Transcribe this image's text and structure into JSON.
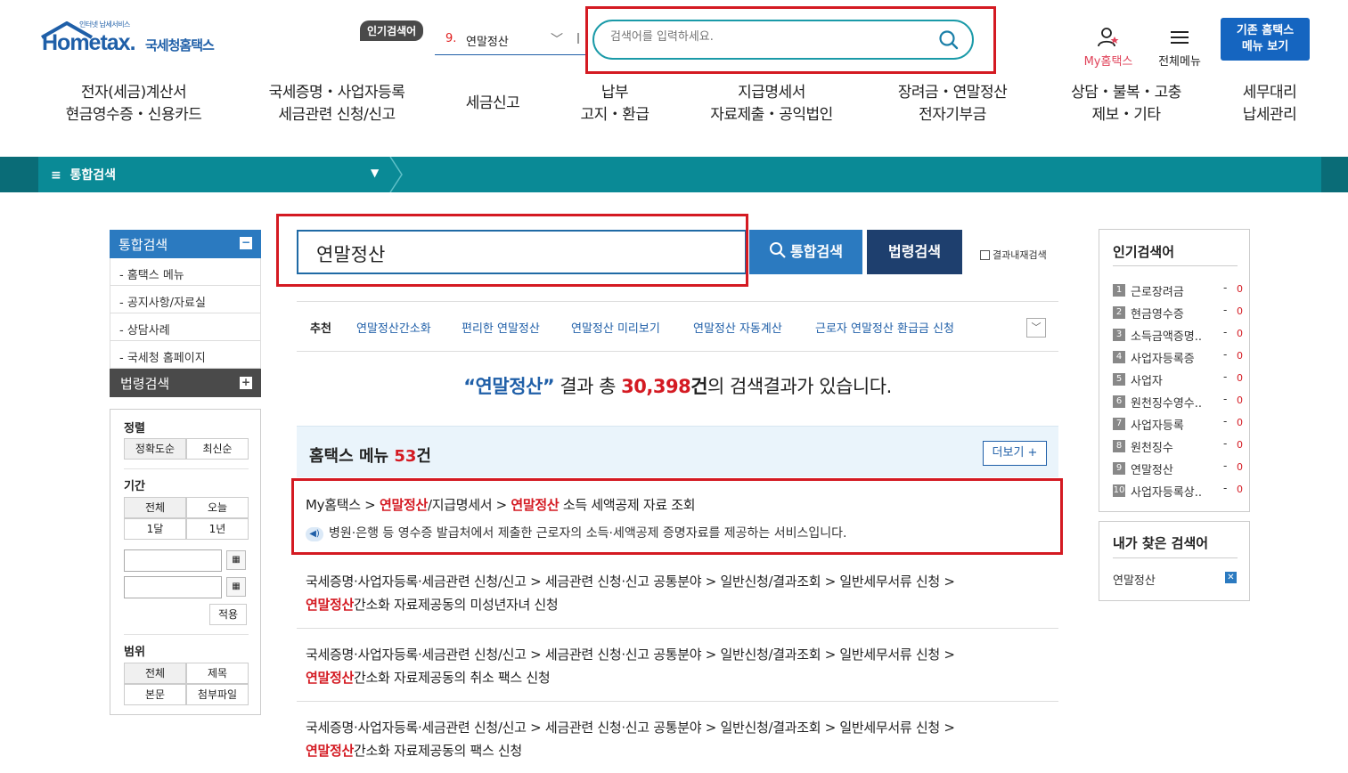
{
  "header": {
    "logo_small": "인터넷 납세서비스",
    "logo_main": "Hometax.",
    "logo_kr": "국세청홈택스",
    "popular_badge": "인기검색어",
    "popular_rank_num": "9.",
    "popular_rank_kw": "연말정산",
    "search_placeholder": "검색어를 입력하세요.",
    "myhometax": "My홈택스",
    "allmenu": "전체메뉴",
    "old_menu_line1": "기존 홈택스",
    "old_menu_line2": "메뉴 보기"
  },
  "gnb": [
    {
      "l1": "전자(세금)계산서",
      "l2": "현금영수증・신용카드"
    },
    {
      "l1": "국세증명・사업자등록",
      "l2": "세금관련 신청/신고"
    },
    {
      "l1": "세금신고",
      "l2": ""
    },
    {
      "l1": "납부",
      "l2": "고지・환급"
    },
    {
      "l1": "지급명세서",
      "l2": "자료제출・공익법인"
    },
    {
      "l1": "장려금・연말정산",
      "l2": "전자기부금"
    },
    {
      "l1": "상담・불복・고충",
      "l2": "제보・기타"
    },
    {
      "l1": "세무대리",
      "l2": "납세관리"
    }
  ],
  "breadcrumb": {
    "label": "통합검색"
  },
  "sidebar": {
    "head1": "통합검색",
    "items": [
      "- 홈택스 메뉴",
      "- 공지사항/자료실",
      "- 상담사례",
      "- 국세청 홈페이지"
    ],
    "head2": "법령검색",
    "sort_title": "정렬",
    "sort_opts": [
      "정확도순",
      "최신순"
    ],
    "period_title": "기간",
    "period_opts": [
      "전체",
      "오늘",
      "1달",
      "1년"
    ],
    "apply": "적용",
    "range_title": "범위",
    "range_opts": [
      "전체",
      "제목",
      "본문",
      "첨부파일"
    ]
  },
  "search": {
    "query": "연말정산",
    "btn_all": "통합검색",
    "btn_law": "법령검색",
    "within": "결과내재검색"
  },
  "recommend": {
    "title": "추천",
    "items": [
      "연말정산간소화",
      "편리한 연말정산",
      "연말정산 미리보기",
      "연말정산 자동계산",
      "근로자 연말정산 환급금 신청"
    ]
  },
  "summary": {
    "query_q": "“연말정산”",
    "middle": " 결과 총 ",
    "count": "30,398",
    "gun": "건",
    "tail": "의 검색결과가 있습니다."
  },
  "section": {
    "title": "홈택스 메뉴 ",
    "count": "53",
    "unit": "건",
    "more": "더보기 +"
  },
  "results": {
    "r1": {
      "a": "My홈택스 > ",
      "b": "연말정산",
      "c": "/지급명세서 > ",
      "d": "연말정산",
      "e": " 소득 세액공제 자료 조회",
      "desc": "병원·은행 등 영수증 발급처에서 제출한 근로자의 소득·세액공제 증명자료를 제공하는 서비스입니다."
    },
    "path": "국세증명·사업자등록·세금관련 신청/신고 > 세금관련 신청·신고 공통분야 > 일반신청/결과조회 > 일반세무서류 신청 >",
    "hl": "연말정산",
    "r2_tail": "간소화 자료제공동의 미성년자녀 신청",
    "r3_tail": "간소화 자료제공동의 취소 팩스 신청",
    "r4_tail": "간소화 자료제공동의 팩스 신청"
  },
  "popular": {
    "title": "인기검색어",
    "items": [
      {
        "no": "1",
        "kw": "근로장려금"
      },
      {
        "no": "2",
        "kw": "현금영수증"
      },
      {
        "no": "3",
        "kw": "소득금액증명.."
      },
      {
        "no": "4",
        "kw": "사업자등록증"
      },
      {
        "no": "5",
        "kw": "사업자"
      },
      {
        "no": "6",
        "kw": "원천징수영수.."
      },
      {
        "no": "7",
        "kw": "사업자등록"
      },
      {
        "no": "8",
        "kw": "원천징수"
      },
      {
        "no": "9",
        "kw": "연말정산"
      },
      {
        "no": "10",
        "kw": "사업자등록상.."
      }
    ],
    "dash": "-",
    "zero": "0"
  },
  "my_search": {
    "title": "내가 찾은 검색어",
    "kw": "연말정산"
  },
  "colors": {
    "brand": "#1f5fa8",
    "teal": "#0a8a96",
    "highlight": "#d41a22"
  }
}
